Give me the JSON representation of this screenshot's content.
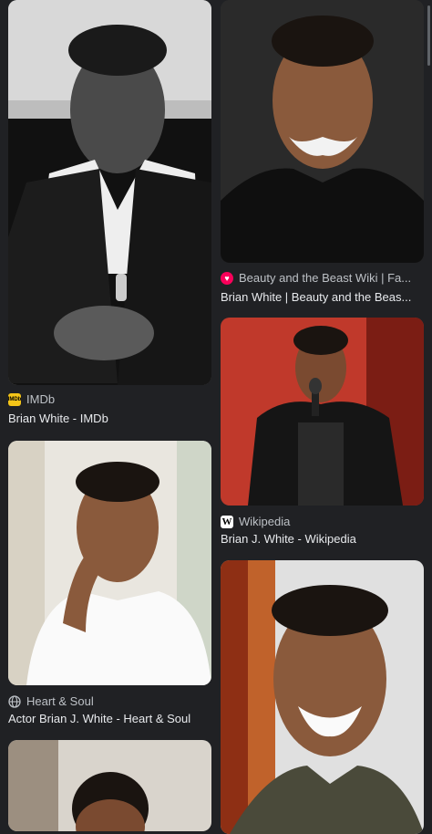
{
  "results": [
    {
      "source": "IMDb",
      "title": "Brian White - IMDb",
      "favicon": "imdb-icon"
    },
    {
      "source": "Beauty and the Beast Wiki | Fa...",
      "title": "Brian White | Beauty and the Beas...",
      "favicon": "fandom-icon"
    },
    {
      "source": "Wikipedia",
      "title": "Brian J. White - Wikipedia",
      "favicon": "wikipedia-icon",
      "favicon_letter": "W"
    },
    {
      "source": "Heart & Soul",
      "title": "Actor Brian J. White - Heart & Soul",
      "favicon": "globe-icon"
    }
  ],
  "colors": {
    "background": "#202124",
    "imdb_yellow": "#f5c518",
    "fandom_red": "#fa005a"
  }
}
